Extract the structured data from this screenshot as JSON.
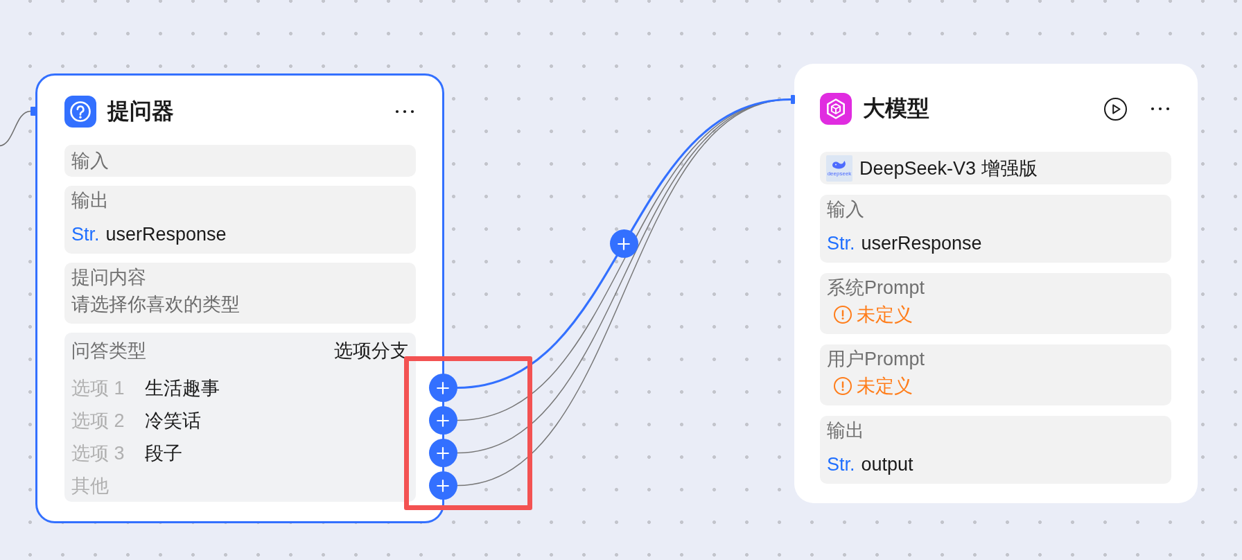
{
  "nodes": [
    {
      "kind": "question",
      "title": "提问器",
      "selected": true,
      "color": "#3370ff",
      "input_from_offscreen": true,
      "sections": [
        {
          "kind": "label",
          "label": "输入"
        },
        {
          "kind": "variable",
          "label": "输出",
          "type": "Str.",
          "name": "userResponse"
        },
        {
          "kind": "text",
          "label": "提问内容",
          "text": "请选择你喜欢的类型"
        },
        {
          "kind": "choice",
          "label": "问答类型",
          "mode": "选项分支",
          "ports_highlighted": true,
          "options": [
            {
              "label": "选项 1",
              "value": "生活趣事",
              "edge_highlighted": true
            },
            {
              "label": "选项 2",
              "value": "冷笑话",
              "edge_highlighted": false
            },
            {
              "label": "选项 3",
              "value": "段子",
              "edge_highlighted": false
            },
            {
              "label": "其他",
              "edge_highlighted": false
            }
          ]
        }
      ]
    },
    {
      "kind": "llm",
      "title": "大模型",
      "selected": false,
      "color": "#e02ce0",
      "input_from_offscreen": false,
      "sections": [
        {
          "kind": "model",
          "logo_text": "deepseek",
          "name": "DeepSeek-V3 增强版"
        },
        {
          "kind": "variable",
          "label": "输入",
          "type": "Str.",
          "name": "userResponse"
        },
        {
          "kind": "warning",
          "label": "系统Prompt",
          "status": "未定义"
        },
        {
          "kind": "warning",
          "label": "用户Prompt",
          "status": "未定义"
        },
        {
          "kind": "variable",
          "label": "输出",
          "type": "Str.",
          "name": "output"
        }
      ]
    }
  ]
}
